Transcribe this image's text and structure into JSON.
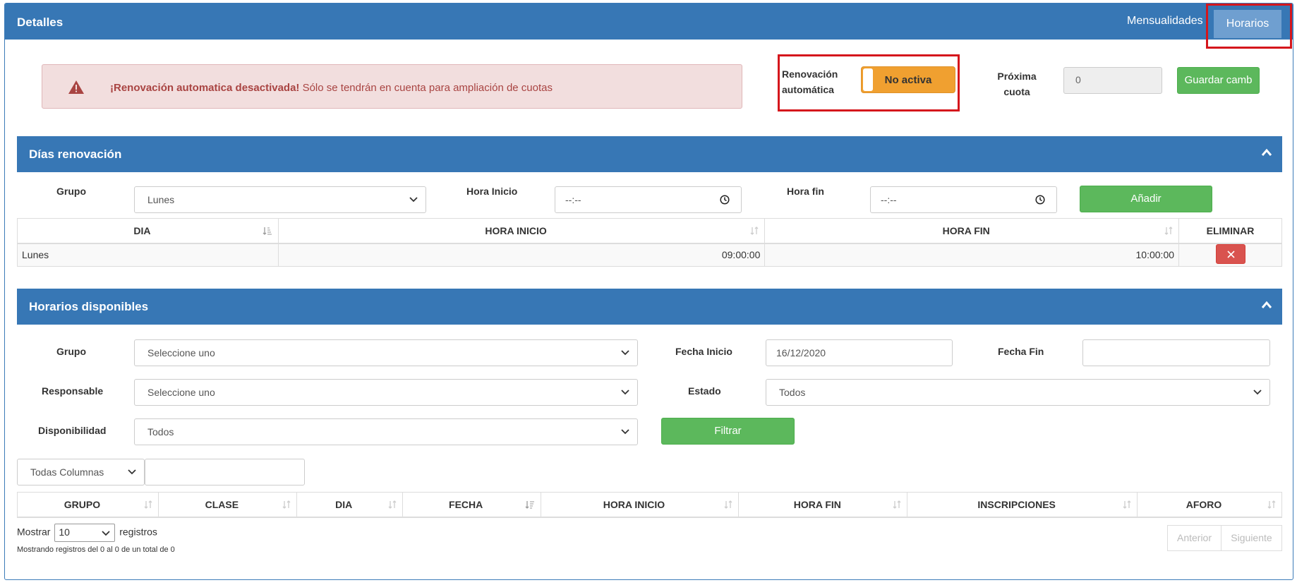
{
  "header": {
    "title": "Detalles",
    "tab_mensualidades": "Mensualidades",
    "tab_horarios": "Horarios"
  },
  "alert": {
    "strong": "¡Renovación automatica desactivada!",
    "text": " Sólo se tendrán en cuenta para ampliación de cuotas"
  },
  "renovacion": {
    "label_line1": "Renovación",
    "label_line2": "automática",
    "toggle_label": "No activa",
    "toggle_on": false
  },
  "proxima": {
    "label_line1": "Próxima",
    "label_line2": "cuota",
    "value": "0"
  },
  "guardar_label": "Guardar camb",
  "dias": {
    "title": "Días renovación",
    "grupo_label": "Grupo",
    "grupo_value": "Lunes",
    "hora_inicio_label": "Hora Inicio",
    "hora_inicio_value": "--:--",
    "hora_fin_label": "Hora fin",
    "hora_fin_value": "--:--",
    "anadir_label": "Añadir",
    "columns": [
      "DIA",
      "HORA INICIO",
      "HORA FIN",
      "ELIMINAR"
    ],
    "rows": [
      {
        "dia": "Lunes",
        "inicio": "09:00:00",
        "fin": "10:00:00"
      }
    ]
  },
  "horarios": {
    "title": "Horarios disponibles",
    "grupo_label": "Grupo",
    "grupo_value": "Seleccione uno",
    "fecha_inicio_label": "Fecha Inicio",
    "fecha_inicio_value": "16/12/2020",
    "fecha_fin_label": "Fecha Fin",
    "fecha_fin_value": "",
    "responsable_label": "Responsable",
    "responsable_value": "Seleccione uno",
    "estado_label": "Estado",
    "estado_value": "Todos",
    "disponibilidad_label": "Disponibilidad",
    "disponibilidad_value": "Todos",
    "filtrar_label": "Filtrar",
    "columnas_value": "Todas Columnas",
    "search_value": "",
    "columns": [
      "GRUPO",
      "CLASE",
      "DIA",
      "FECHA",
      "HORA INICIO",
      "HORA FIN",
      "INSCRIPCIONES",
      "AFORO"
    ],
    "mostrar": "Mostrar",
    "page_size": "10",
    "registros": "registros",
    "info": "Mostrando registros del 0 al 0 de un total de 0",
    "anterior": "Anterior",
    "siguiente": "Siguiente"
  },
  "colors": {
    "primary": "#3777b5",
    "success": "#5cb85c",
    "danger": "#d9534f",
    "warning": "#f0a030",
    "highlight": "#d5161c"
  }
}
